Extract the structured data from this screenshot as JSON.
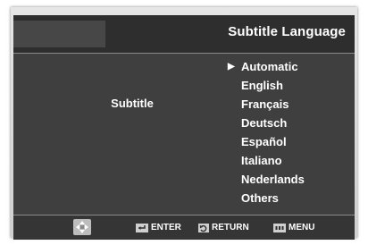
{
  "header": {
    "title": "Subtitle Language"
  },
  "setting": {
    "label": "Subtitle",
    "selected_marker": "▶",
    "options": [
      "Automatic",
      "English",
      "Français",
      "Deutsch",
      "Español",
      "Italiano",
      "Nederlands",
      "Others"
    ]
  },
  "footer": {
    "enter_label": "ENTER",
    "return_label": "RETURN",
    "menu_label": "MENU",
    "icons": [
      "dpad-icon",
      "enter-key-icon",
      "return-key-icon",
      "menu-key-icon"
    ]
  },
  "colors": {
    "background": "#3f3f3f",
    "header": "#2e2e2e",
    "text": "#ffffff",
    "frame": "#d9d9d9"
  }
}
